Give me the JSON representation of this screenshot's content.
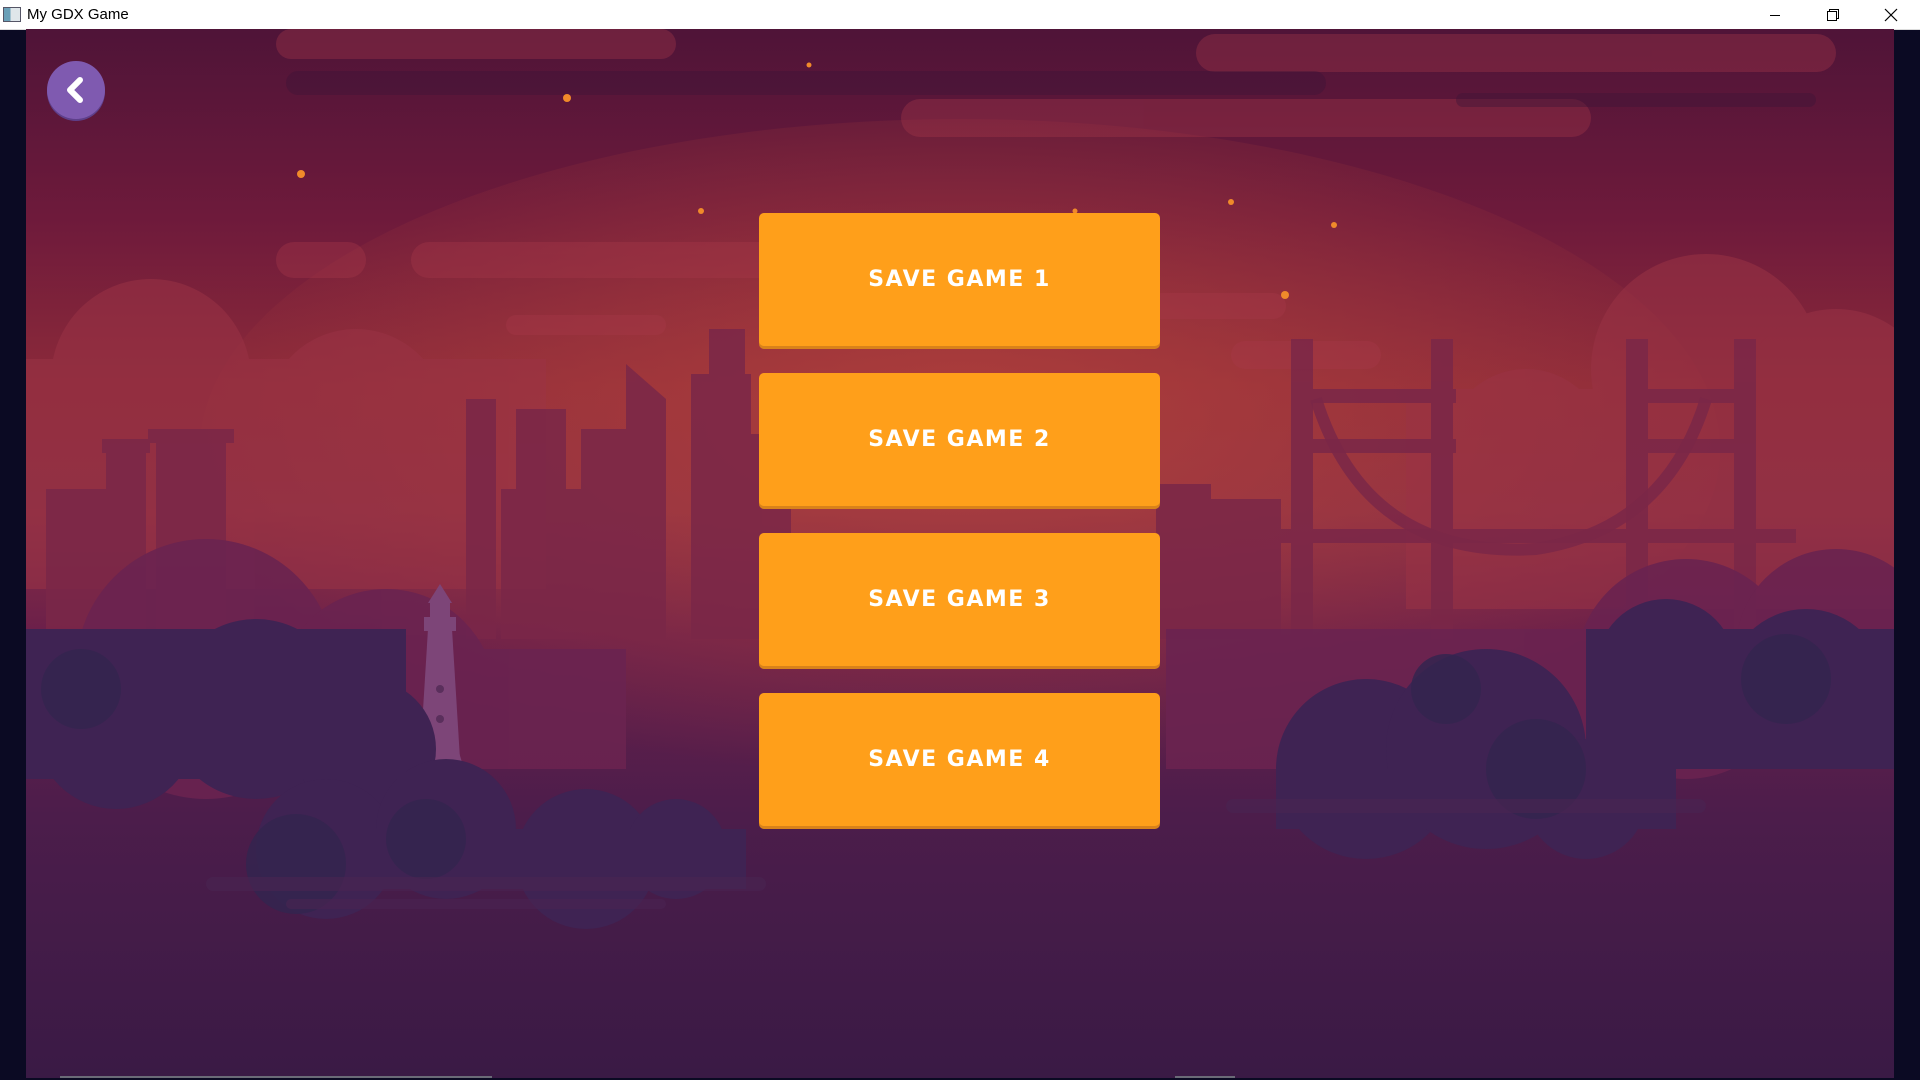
{
  "window": {
    "title": "My GDX Game",
    "controls": [
      "minimize",
      "restore",
      "close"
    ]
  },
  "icons": {
    "app": "gdx-app-icon",
    "back": "chevron-left-icon"
  },
  "menu": {
    "buttons": [
      {
        "label": "SAVE GAME 1"
      },
      {
        "label": "SAVE GAME 2"
      },
      {
        "label": "SAVE GAME 3"
      },
      {
        "label": "SAVE GAME 4"
      }
    ]
  },
  "colors": {
    "button": "#ff9f1a",
    "button_text": "#ffffff",
    "back_button": "#7f5ab0",
    "sky_top": "#4f1438",
    "horizon": "#8c2a3a",
    "ground": "#3a1a45"
  }
}
